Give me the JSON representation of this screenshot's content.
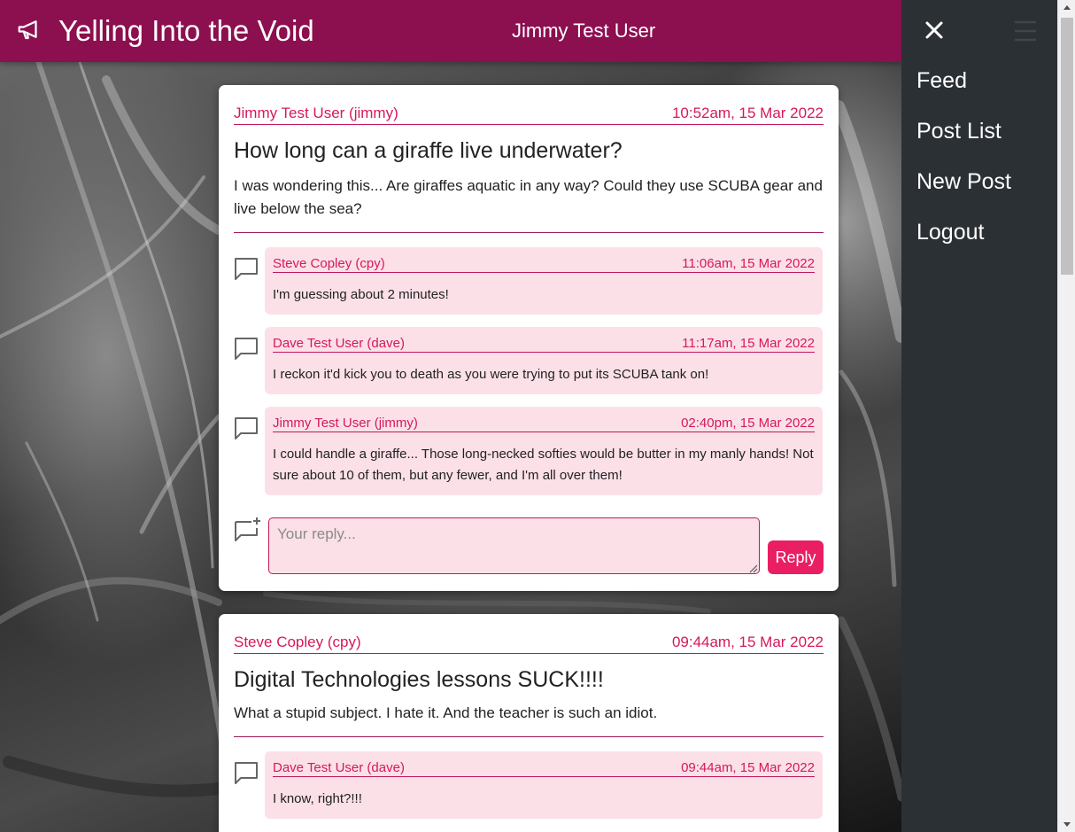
{
  "app": {
    "title": "Yelling Into the Void",
    "current_user": "Jimmy Test User"
  },
  "nav": {
    "items": [
      {
        "label": "Feed"
      },
      {
        "label": "Post List"
      },
      {
        "label": "New Post"
      },
      {
        "label": "Logout"
      }
    ]
  },
  "posts": [
    {
      "author": "Jimmy Test User (jimmy)",
      "time": "10:52am, 15 Mar 2022",
      "title": "How long can a giraffe live underwater?",
      "body": "I was wondering this... Are giraffes aquatic in any way? Could they use SCUBA gear and live below the sea?",
      "comments": [
        {
          "author": "Steve Copley (cpy)",
          "time": "11:06am, 15 Mar 2022",
          "body": "I'm guessing about 2 minutes!"
        },
        {
          "author": "Dave Test User (dave)",
          "time": "11:17am, 15 Mar 2022",
          "body": "I reckon it'd kick you to death as you were trying to put its SCUBA tank on!"
        },
        {
          "author": "Jimmy Test User (jimmy)",
          "time": "02:40pm, 15 Mar 2022",
          "body": "I could handle a giraffe... Those long-necked softies would be butter in my manly hands! Not sure about 10 of them, but any fewer, and I'm all over them!"
        }
      ],
      "reply": {
        "placeholder": "Your reply...",
        "button": "Reply"
      }
    },
    {
      "author": "Steve Copley (cpy)",
      "time": "09:44am, 15 Mar 2022",
      "title": "Digital Technologies lessons SUCK!!!!",
      "body": "What a stupid subject. I hate it. And the teacher is such an idiot.",
      "comments": [
        {
          "author": "Dave Test User (dave)",
          "time": "09:44am, 15 Mar 2022",
          "body": "I know, right?!!!"
        }
      ]
    }
  ],
  "icons": {
    "brand": "megaphone-icon",
    "close": "close-icon",
    "menu": "hamburger-icon",
    "comment": "comment-icon",
    "reply": "add-comment-icon"
  },
  "colors": {
    "header": "#8c0f50",
    "accent": "#e91e63",
    "comment_bg": "#fbe0e8",
    "sidepanel": "#2b3035"
  }
}
